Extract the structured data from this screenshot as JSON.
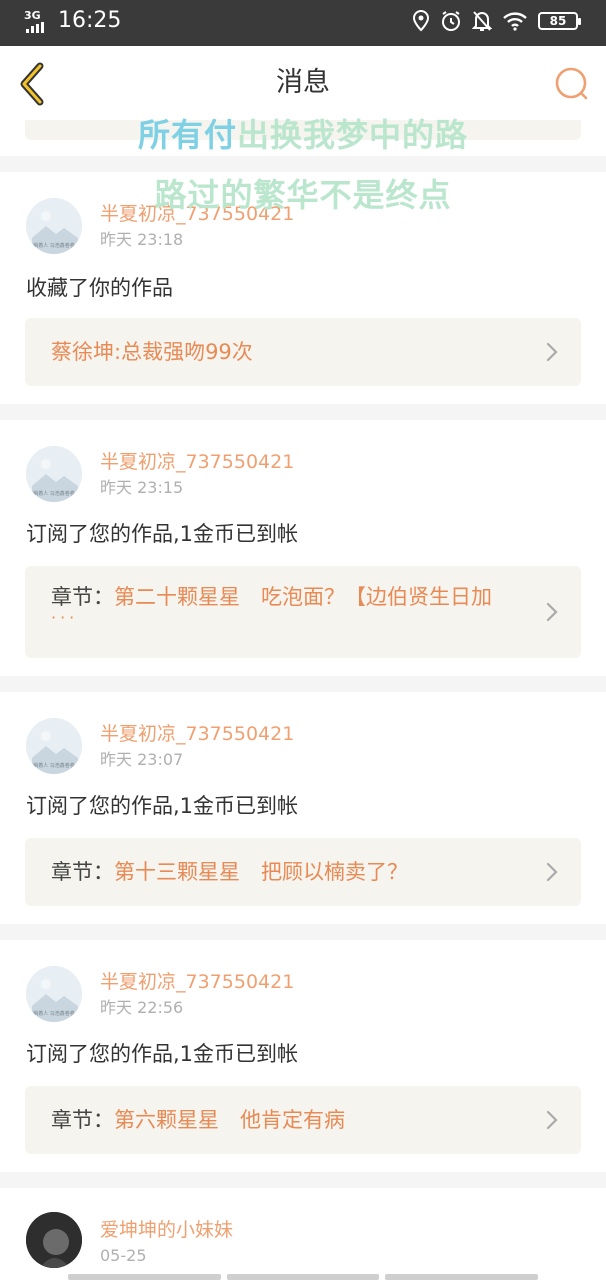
{
  "status_bar": {
    "network": "3G",
    "time": "16:25",
    "battery": "85",
    "icons": [
      "location-icon",
      "alarm-icon",
      "bell-off-icon",
      "wifi-icon",
      "battery-icon"
    ]
  },
  "header": {
    "title": "消息",
    "back_icon": "chevron-left-icon",
    "search_icon": "search-icon",
    "accent_color": "#f0a070"
  },
  "overlay": {
    "line1_a": "所有付",
    "line1_b": "出换我梦中的路",
    "line2": "路过的繁华不是终点"
  },
  "messages": [
    {
      "user": "半夏初凉_737550421",
      "time": "昨天 23:18",
      "action": "收藏了你的作品",
      "link_prefix": "",
      "link_text": "蔡徐坤:总裁强吻99次",
      "ellipsis": ""
    },
    {
      "user": "半夏初凉_737550421",
      "time": "昨天 23:15",
      "action": "订阅了您的作品,1金币已到帐",
      "link_prefix": "章节：",
      "link_text": "第二十颗星星　吃泡面？【边伯贤生日加",
      "ellipsis": "···"
    },
    {
      "user": "半夏初凉_737550421",
      "time": "昨天 23:07",
      "action": "订阅了您的作品,1金币已到帐",
      "link_prefix": "章节：",
      "link_text": "第十三颗星星　把顾以楠卖了？",
      "ellipsis": ""
    },
    {
      "user": "半夏初凉_737550421",
      "time": "昨天 22:56",
      "action": "订阅了您的作品,1金币已到帐",
      "link_prefix": "章节：",
      "link_text": "第六颗星星　他肯定有病",
      "ellipsis": ""
    },
    {
      "user": "爱坤坤的小妹妹",
      "time": "05-25"
    }
  ]
}
